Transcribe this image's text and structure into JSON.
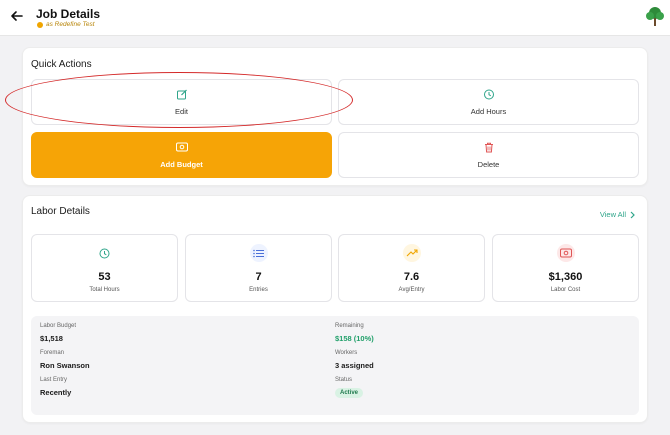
{
  "header": {
    "title": "Job Details",
    "subtitle": "as Redefine Test"
  },
  "quick_actions": {
    "title": "Quick Actions",
    "buttons": [
      {
        "label": "Edit",
        "icon": "edit-icon"
      },
      {
        "label": "Add Hours",
        "icon": "clock-icon"
      },
      {
        "label": "Add Budget",
        "icon": "money-icon"
      },
      {
        "label": "Delete",
        "icon": "trash-icon"
      }
    ]
  },
  "labor": {
    "title": "Labor Details",
    "view_all": "View All",
    "stats": [
      {
        "value": "53",
        "label": "Total Hours",
        "icon": "clock-icon"
      },
      {
        "value": "7",
        "label": "Entries",
        "icon": "list-icon"
      },
      {
        "value": "7.6",
        "label": "Avg/Entry",
        "icon": "trend-up-icon"
      },
      {
        "value": "$1,360",
        "label": "Labor Cost",
        "icon": "money-icon"
      }
    ],
    "details": {
      "budget_label": "Labor Budget",
      "budget_value": "$1,518",
      "remaining_label": "Remaining",
      "remaining_value": "$158 (10%)",
      "foreman_label": "Foreman",
      "foreman_value": "Ron Swanson",
      "workers_label": "Workers",
      "workers_value": "3 assigned",
      "last_entry_label": "Last Entry",
      "last_entry_value": "Recently",
      "status_label": "Status",
      "status_value": "Active"
    }
  },
  "colors": {
    "accent": "#f6a406",
    "teal": "#2fa58a",
    "danger": "#e05555",
    "annotation": "#d42a2a"
  }
}
